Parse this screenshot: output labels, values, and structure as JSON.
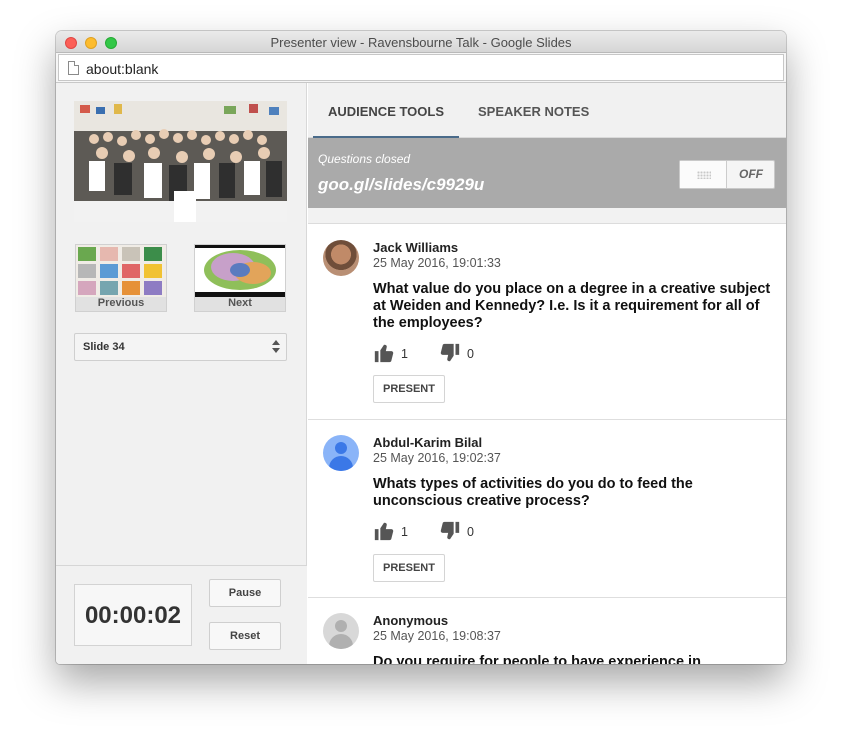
{
  "window": {
    "title": "Presenter view - Ravensbourne Talk - Google Slides"
  },
  "address": {
    "url": "about:blank"
  },
  "slides": {
    "previous_label": "Previous",
    "next_label": "Next",
    "selector_value": "Slide 34"
  },
  "timer": {
    "time": "00:00:02",
    "pause_label": "Pause",
    "reset_label": "Reset"
  },
  "tabs": [
    {
      "label": "AUDIENCE TOOLS",
      "active": true
    },
    {
      "label": "SPEAKER NOTES",
      "active": false
    }
  ],
  "questions_panel": {
    "status": "Questions closed",
    "link": "goo.gl/slides/c9929u",
    "toggle_label": "OFF"
  },
  "questions": [
    {
      "name": "Jack Williams",
      "date": "25 May 2016, 19:01:33",
      "text": "What value do you place on a degree in a creative subject at Weiden and Kennedy? I.e. Is it a requirement for all of the employees?",
      "upvotes": "1",
      "downvotes": "0",
      "present_label": "PRESENT",
      "avatar": "photo"
    },
    {
      "name": "Abdul-Karim Bilal",
      "date": "25 May 2016, 19:02:37",
      "text": "Whats types of activities do you do to feed the unconscious creative process?",
      "upvotes": "1",
      "downvotes": "0",
      "present_label": "PRESENT",
      "avatar": "person-icon"
    },
    {
      "name": "Anonymous",
      "date": "25 May 2016, 19:08:37",
      "text": "Do you require for people to have experience in",
      "avatar": "anonymous-icon"
    }
  ],
  "colors": {
    "header_grey": "#aaaaaa",
    "tab_underline": "#4a6b8a",
    "avatar_blue": "#8ab4f8"
  }
}
